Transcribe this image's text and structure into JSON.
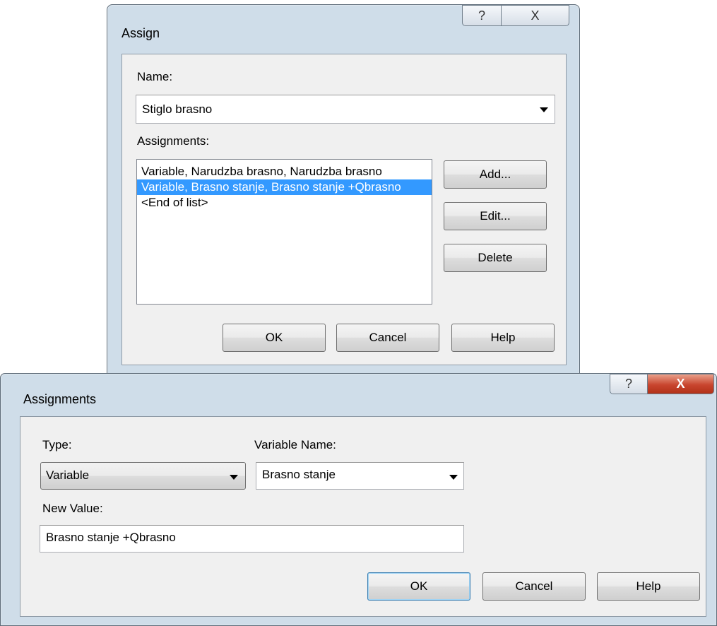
{
  "assign_dialog": {
    "title": "Assign",
    "help_glyph": "?",
    "close_glyph": "X",
    "name_label": "Name:",
    "name_value": "Stiglo brasno",
    "assignments_label": "Assignments:",
    "list_items": [
      "Variable, Narudzba brasno, Narudzba brasno",
      "Variable, Brasno stanje, Brasno stanje +Qbrasno",
      "<End of list>"
    ],
    "selected_index": 1,
    "add_label": "Add...",
    "edit_label": "Edit...",
    "delete_label": "Delete",
    "ok_label": "OK",
    "cancel_label": "Cancel",
    "help_label": "Help"
  },
  "assignments_dialog": {
    "title": "Assignments",
    "help_glyph": "?",
    "close_glyph": "X",
    "type_label": "Type:",
    "type_value": "Variable",
    "variable_name_label": "Variable Name:",
    "variable_name_value": "Brasno stanje",
    "new_value_label": "New Value:",
    "new_value_value": "Brasno stanje +Qbrasno",
    "ok_label": "OK",
    "cancel_label": "Cancel",
    "help_label": "Help"
  }
}
